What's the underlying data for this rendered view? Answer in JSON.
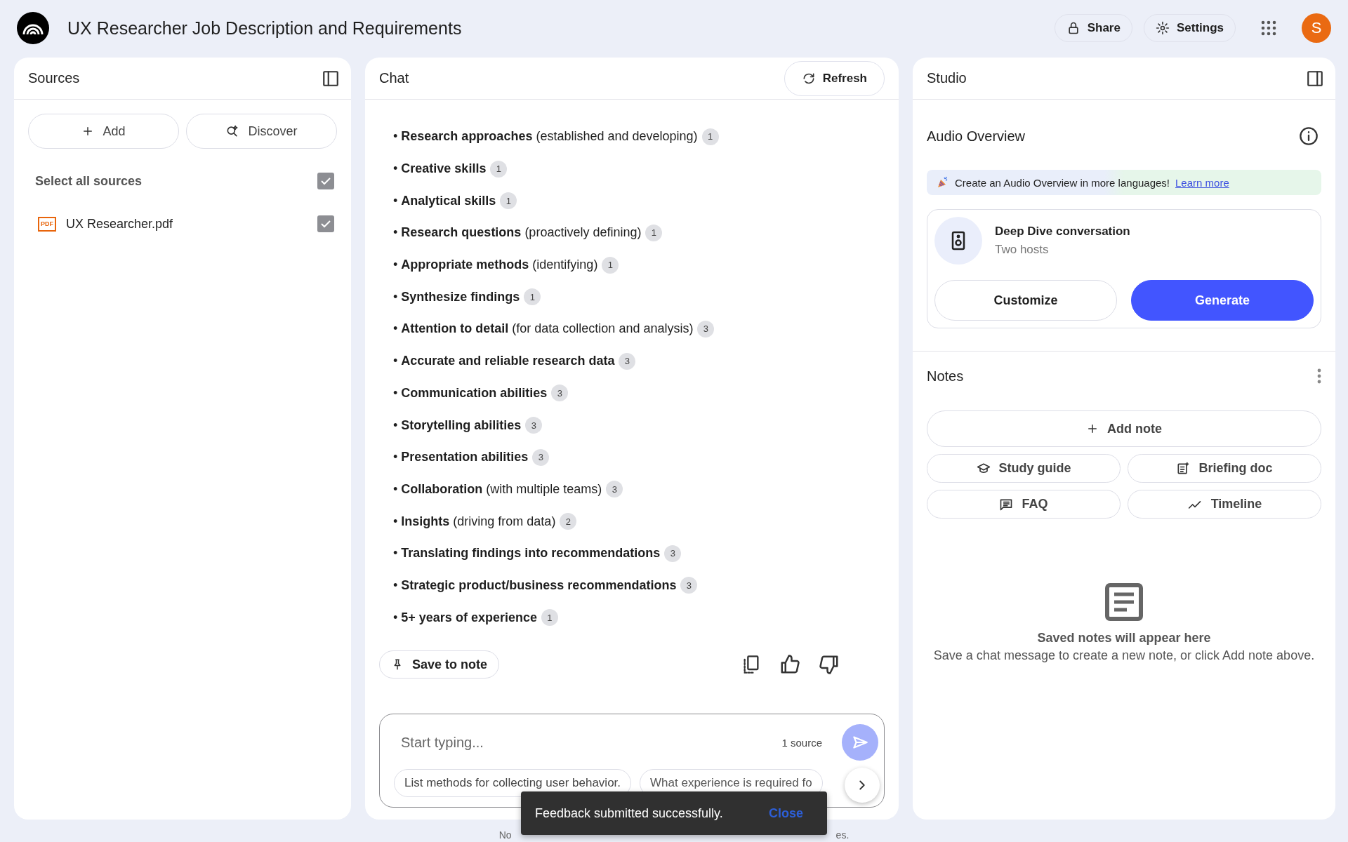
{
  "header": {
    "title": "UX Researcher Job Description and Requirements",
    "buttons": [
      {
        "kind": "share",
        "label": "Share"
      },
      {
        "kind": "settings",
        "label": "Settings"
      }
    ],
    "avatar": "S"
  },
  "sources": {
    "title": "Sources",
    "buttons": [
      {
        "kind": "add",
        "label": "Add"
      },
      {
        "kind": "discover",
        "label": "Discover"
      }
    ],
    "select_all": {
      "label": "Select all sources",
      "checked": true
    },
    "items": [
      {
        "name": "UX Researcher.pdf",
        "badge": "PDF",
        "checked": true
      }
    ]
  },
  "chat": {
    "title": "Chat",
    "refresh": "Refresh",
    "items": [
      {
        "text": "• **Research approaches** (established and developing)",
        "cite": "1"
      },
      {
        "text": "• **Creative skills**",
        "cite": "1"
      },
      {
        "text": "• **Analytical skills**",
        "cite": "1"
      },
      {
        "text": "• **Research questions** (proactively defining)",
        "cite": "1"
      },
      {
        "text": "• **Appropriate methods** (identifying)",
        "cite": "1"
      },
      {
        "text": "• **Synthesize findings**",
        "cite": "1"
      },
      {
        "text": "• **Attention to detail** (for data collection and analysis)",
        "cite": "3"
      },
      {
        "text": "• **Accurate and reliable research data**",
        "cite": "3"
      },
      {
        "text": "• **Communication abilities**",
        "cite": "3"
      },
      {
        "text": "• **Storytelling abilities**",
        "cite": "3"
      },
      {
        "text": "• **Presentation abilities**",
        "cite": "3"
      },
      {
        "text": "• **Collaboration** (with multiple teams)",
        "cite": "3"
      },
      {
        "text": "• **Insights** (driving from data)",
        "cite": "2"
      },
      {
        "text": "• **Translating findings into recommendations**",
        "cite": "3"
      },
      {
        "text": "• **Strategic product/business recommendations**",
        "cite": "3"
      },
      {
        "text": "• **5+ years of experience**",
        "cite": "1"
      }
    ],
    "save_to_note": "Save to note",
    "input": {
      "placeholder": "Start typing...",
      "source_count": "1 source"
    },
    "suggestions": [
      "List methods for collecting user behavior.",
      "What experience is required fo"
    ]
  },
  "studio": {
    "title": "Studio",
    "audio": {
      "title": "Audio Overview",
      "banner": "Create an Audio Overview in more languages!",
      "banner_link": "Learn more",
      "card_title": "Deep Dive conversation",
      "card_subtitle": "Two hosts",
      "buttons": [
        {
          "kind": "outline",
          "label": "Customize"
        },
        {
          "kind": "primary",
          "label": "Generate"
        }
      ]
    },
    "notes": {
      "title": "Notes",
      "add_note": "Add note",
      "buttons": [
        {
          "kind": "study",
          "label": "Study guide"
        },
        {
          "kind": "briefing",
          "label": "Briefing doc"
        },
        {
          "kind": "faq",
          "label": "FAQ"
        },
        {
          "kind": "timeline",
          "label": "Timeline"
        }
      ],
      "empty_title": "Saved notes will appear here",
      "empty_text": "Save a chat message to create a new note, or click Add note above."
    }
  },
  "footer": [
    "No",
    "es."
  ],
  "toast": {
    "message": "Feedback submitted successfully.",
    "action": "Close"
  }
}
